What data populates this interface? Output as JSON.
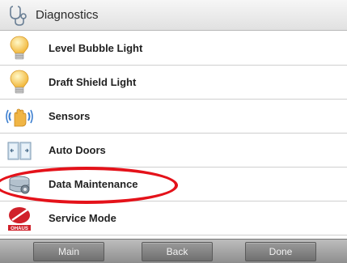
{
  "header": {
    "title": "Diagnostics",
    "icon": "stethoscope-icon"
  },
  "menu": {
    "items": [
      {
        "label": "Level Bubble Light",
        "icon": "light-bulb-icon"
      },
      {
        "label": "Draft Shield Light",
        "icon": "light-bulb-icon"
      },
      {
        "label": "Sensors",
        "icon": "hand-sensor-icon"
      },
      {
        "label": "Auto Doors",
        "icon": "doors-icon"
      },
      {
        "label": "Data Maintenance",
        "icon": "data-maintenance-icon"
      },
      {
        "label": "Service Mode",
        "icon": "ohaus-logo-icon",
        "logo_text": "OHAUS"
      }
    ]
  },
  "footer": {
    "main_label": "Main",
    "back_label": "Back",
    "done_label": "Done"
  },
  "colors": {
    "highlight": "#e4121a",
    "header_bg": "#e8e8e8",
    "footer_bg": "#9a9a9a",
    "ohaus_red": "#d0202a"
  }
}
